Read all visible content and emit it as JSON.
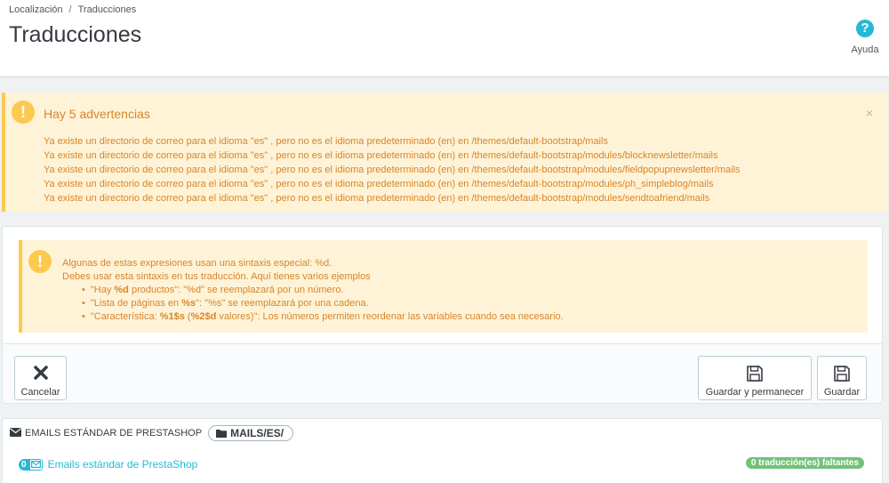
{
  "breadcrumb": {
    "parent": "Localización",
    "separator": "/",
    "current": "Traducciones"
  },
  "page": {
    "title": "Traducciones"
  },
  "help": {
    "label": "Ayuda",
    "icon": "question-circle-icon"
  },
  "warnings": {
    "title": "Hay 5 advertencias",
    "close": "×",
    "lines": [
      "Ya existe un directorio de correo para el idioma \"es\" , pero no es el idioma predeterminado (en) en /themes/default-bootstrap/mails",
      "Ya existe un directorio de correo para el idioma \"es\" , pero no es el idioma predeterminado (en) en /themes/default-bootstrap/modules/blocknewsletter/mails",
      "Ya existe un directorio de correo para el idioma \"es\" , pero no es el idioma predeterminado (en) en /themes/default-bootstrap/modules/fieldpopupnewsletter/mails",
      "Ya existe un directorio de correo para el idioma \"es\" , pero no es el idioma predeterminado (en) en /themes/default-bootstrap/modules/ph_simpleblog/mails",
      "Ya existe un directorio de correo para el idioma \"es\" , pero no es el idioma predeterminado (en) en /themes/default-bootstrap/modules/sendtoafriend/mails"
    ]
  },
  "syntax_info": {
    "line1": "Algunas de estas expresiones usan una sintaxis especial: %d.",
    "line2": "Debes usar esta sintaxis en tus traducción. Aquí tienes varios ejemplos",
    "ex1_pre": "\"Hay ",
    "ex1_bold": "%d",
    "ex1_post": " productos\": \"%d\" se reemplazará por un número.",
    "ex2_pre": "\"Lista de páginas en ",
    "ex2_bold": "%s",
    "ex2_post": "\": \"%s\" se reemplazará por una cadena.",
    "ex3_pre": "\"Característica: ",
    "ex3_bold1": "%1$s",
    "ex3_mid": " (",
    "ex3_bold2": "%2$d",
    "ex3_post": " valores)\": Los números permiten reordenar las variables cuando sea necesario."
  },
  "toolbar": {
    "cancel_label": "Cancelar",
    "save_stay_label": "Guardar y permanecer",
    "save_label": "Guardar"
  },
  "mails": {
    "section_title": "EMAILS ESTÁNDAR DE PRESTASHOP",
    "path": "MAILS/ES/",
    "link_count": "0",
    "link_label": "Emails estándar de PrestaShop",
    "missing_badge": "0 traducción(es) faltantes"
  },
  "colors": {
    "accent": "#25b9d7",
    "warning_bg": "#fff3d7",
    "warning_text": "#d5862b",
    "warning_icon": "#fcc94f",
    "success": "#72c279"
  }
}
